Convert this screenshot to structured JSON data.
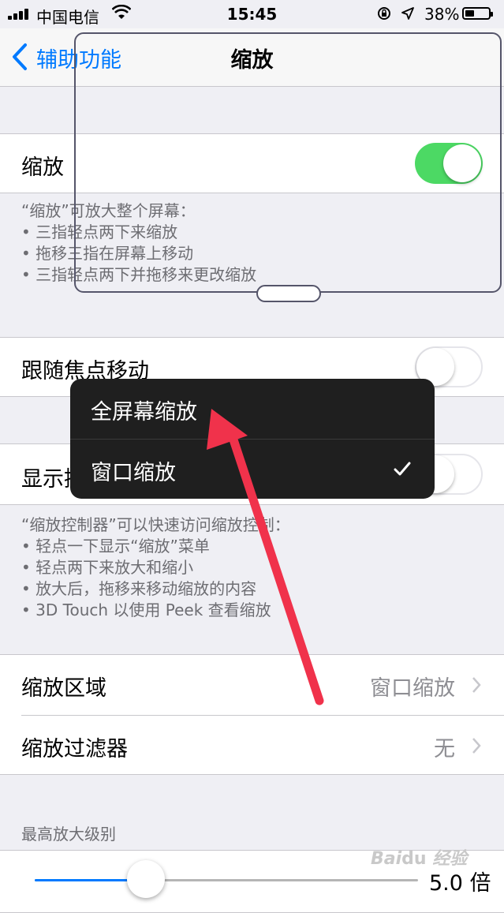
{
  "status_bar": {
    "carrier": "中国电信",
    "time": "15:45",
    "battery_percent": "38%",
    "battery_level": 0.38,
    "icons": [
      "signal-icon",
      "wifi-icon",
      "rotation-lock-icon",
      "location-arrow-icon",
      "battery-icon"
    ]
  },
  "nav": {
    "back_label": "辅助功能",
    "title": "缩放"
  },
  "zoom_cell": {
    "label": "缩放",
    "toggle_on": true
  },
  "zoom_footer": {
    "intro": "“缩放”可放大整个屏幕：",
    "lines": [
      "• 三指轻点两下来缩放",
      "• 拖移三指在屏幕上移动",
      "• 三指轻点两下并拖移来更改缩放"
    ]
  },
  "follow_focus": {
    "label": "跟随焦点移动",
    "toggle_on": false
  },
  "show_controller": {
    "label": "显示控制器",
    "visible_label": "显示控",
    "toggle_on": false
  },
  "controller_footer": {
    "intro": "“缩放控制器”可以快速访问缩放控制：",
    "lines": [
      "• 轻点一下显示“缩放”菜单",
      "• 轻点两下来放大和缩小",
      "• 放大后，拖移来移动缩放的内容",
      "• 3D Touch 以使用 Peek 查看缩放"
    ]
  },
  "zoom_region": {
    "label": "缩放区域",
    "value": "窗口缩放"
  },
  "zoom_filter": {
    "label": "缩放过滤器",
    "value": "无"
  },
  "max_zoom": {
    "header": "最高放大级别",
    "value_label": "5.0 倍",
    "slider_fraction": 0.29
  },
  "popup_menu": {
    "items": [
      {
        "label": "全屏幕缩放",
        "checked": false
      },
      {
        "label": "窗口缩放",
        "checked": true
      }
    ]
  },
  "colors": {
    "accent": "#007aff",
    "switch_on": "#4cd964",
    "annotation_arrow": "#f0324b"
  },
  "watermark": "Baidu 经验"
}
